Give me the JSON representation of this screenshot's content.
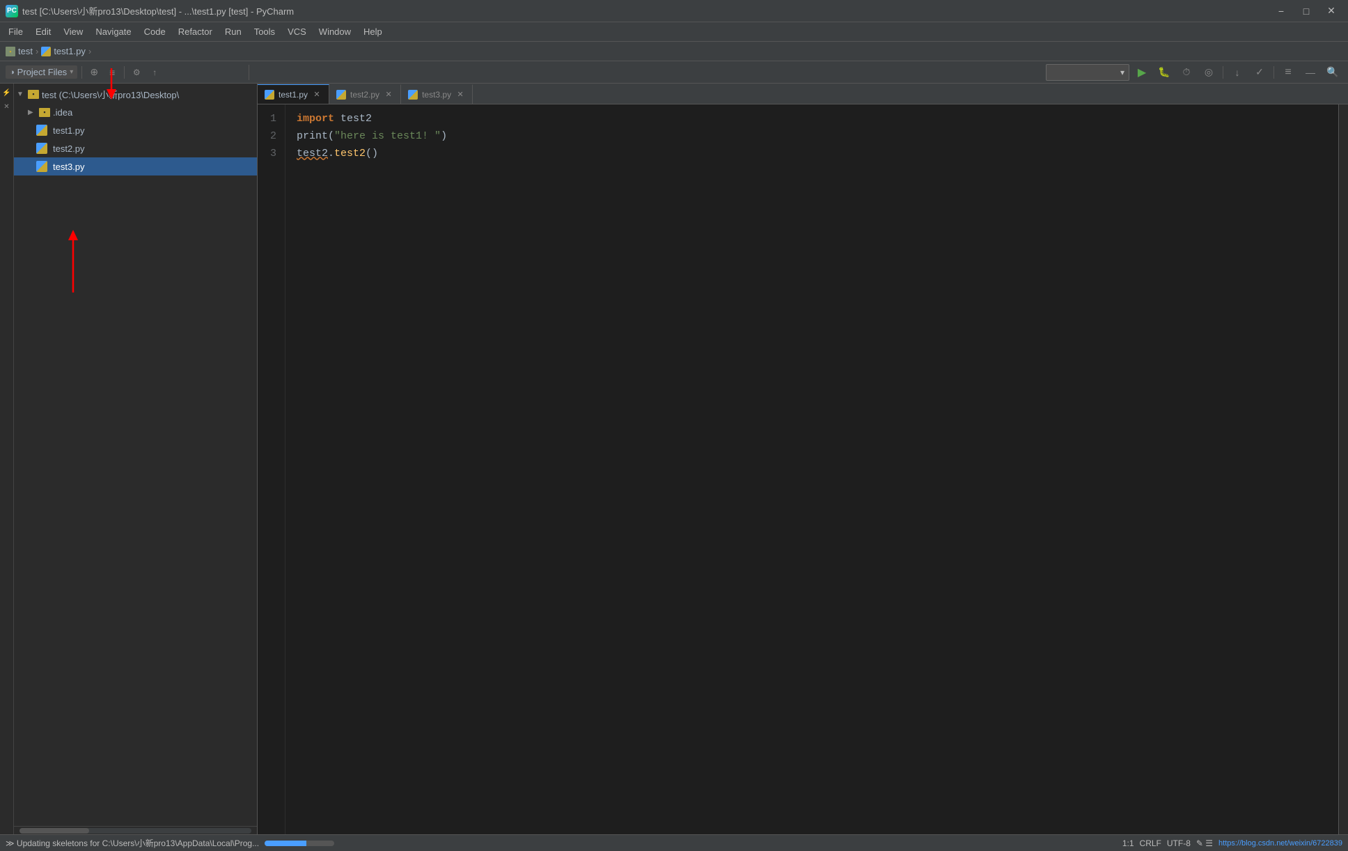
{
  "titleBar": {
    "icon": "PC",
    "title": "test [C:\\Users\\小新pro13\\Desktop\\test] - ...\\test1.py [test] - PyCharm",
    "minimize": "−",
    "maximize": "□",
    "close": "✕"
  },
  "menuBar": {
    "items": [
      "File",
      "Edit",
      "View",
      "Navigate",
      "Code",
      "Refactor",
      "Run",
      "Tools",
      "VCS",
      "Window",
      "Help"
    ]
  },
  "breadcrumb": {
    "folder": "test",
    "file": "test1.py",
    "sep": "›"
  },
  "projectPanel": {
    "title": "Project Files",
    "dropdownIcon": "▾",
    "addIcon": "+",
    "settingsIcon": "⚙",
    "collapseIcon": "↑",
    "syncIcon": "⟳",
    "treeItems": [
      {
        "label": "test (C:\\Users\\小新pro13\\Desktop\\",
        "type": "root",
        "indent": 0,
        "expanded": true
      },
      {
        "label": ".idea",
        "type": "folder",
        "indent": 1,
        "expanded": false
      },
      {
        "label": "test1.py",
        "type": "py",
        "indent": 1
      },
      {
        "label": "test2.py",
        "type": "py",
        "indent": 1
      },
      {
        "label": "test3.py",
        "type": "py",
        "indent": 1,
        "selected": true
      }
    ]
  },
  "tabs": [
    {
      "label": "test1.py",
      "active": true
    },
    {
      "label": "test2.py",
      "active": false
    },
    {
      "label": "test3.py",
      "active": false
    }
  ],
  "codeLines": [
    {
      "num": "1",
      "tokens": [
        {
          "text": "import",
          "class": "kw-import"
        },
        {
          "text": " test2",
          "class": "module-ref"
        }
      ]
    },
    {
      "num": "2",
      "tokens": [
        {
          "text": "print",
          "class": "kw-print"
        },
        {
          "text": "(\"here is test1! \")",
          "class": "str-val"
        }
      ]
    },
    {
      "num": "3",
      "tokens": [
        {
          "text": "test2",
          "class": "module-ref underline"
        },
        {
          "text": ".test2()",
          "class": "func-call"
        }
      ]
    }
  ],
  "statusBar": {
    "updating": "≫ Updating skeletons for C:\\Users\\小新pro13\\AppData\\Local\\Prog...",
    "position": "1:1",
    "lineEnding": "CRLF",
    "encoding": "UTF-8",
    "extraIcons": "✎ ☰",
    "progressWidth": "60%",
    "url": "https://blog.csdn.net/weixin/6722839"
  }
}
